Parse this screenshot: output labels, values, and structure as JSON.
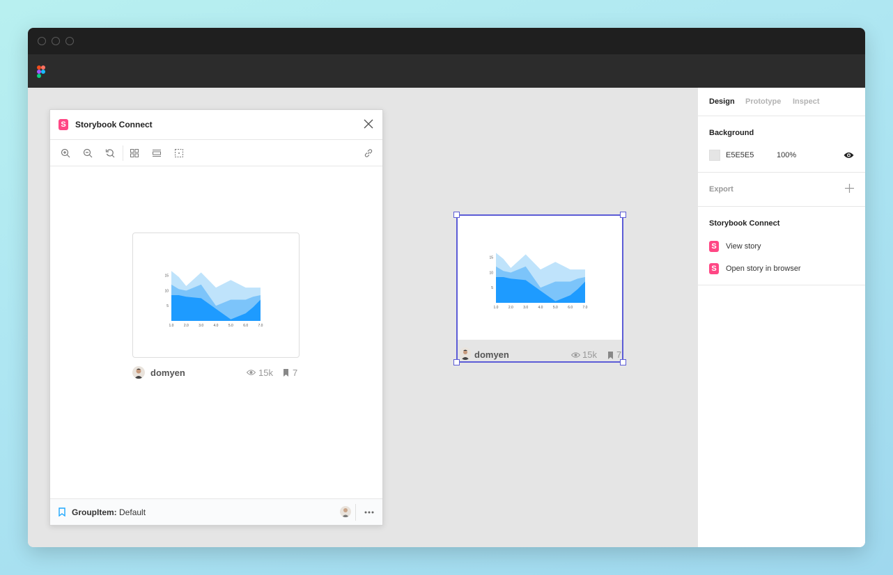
{
  "plugin": {
    "title": "Storybook Connect",
    "footer_component": "GroupItem:",
    "footer_variant": "Default"
  },
  "story_card": {
    "username": "domyen",
    "views": "15k",
    "bookmarks": "7"
  },
  "frame_card": {
    "username": "domyen",
    "views": "15k",
    "bookmarks": "7"
  },
  "panel": {
    "tabs": [
      "Design",
      "Prototype",
      "Inspect"
    ],
    "background_title": "Background",
    "background_hex": "E5E5E5",
    "background_opacity": "100%",
    "export_title": "Export",
    "storybook_title": "Storybook Connect",
    "view_story": "View story",
    "open_story": "Open story in browser"
  },
  "colors": {
    "accent": "#5b5bd6",
    "storybook": "#ff4785",
    "series_light": "#bfe3fb",
    "series_mid": "#7cc4fa",
    "series_dark": "#1e9bff"
  },
  "chart_data": {
    "type": "area",
    "x_tick_labels": [
      "1.0",
      "2.0",
      "3.0",
      "4.0",
      "5.0",
      "6.0",
      "7.0"
    ],
    "y_tick_labels": [
      "5",
      "10",
      "15"
    ],
    "x": [
      1.0,
      1.5,
      2.0,
      3.0,
      4.0,
      5.0,
      6.0,
      6.5,
      7.0
    ],
    "ylim": [
      0,
      17
    ],
    "series": [
      {
        "values": [
          16.5,
          14.5,
          11.5,
          16,
          11,
          13.5,
          11,
          11,
          11
        ]
      },
      {
        "values": [
          12,
          10.5,
          10,
          12,
          5,
          7,
          7,
          8,
          8.5
        ]
      },
      {
        "values": [
          8.5,
          8.5,
          8,
          7.5,
          4,
          0.5,
          2.5,
          4.5,
          7
        ]
      }
    ]
  }
}
